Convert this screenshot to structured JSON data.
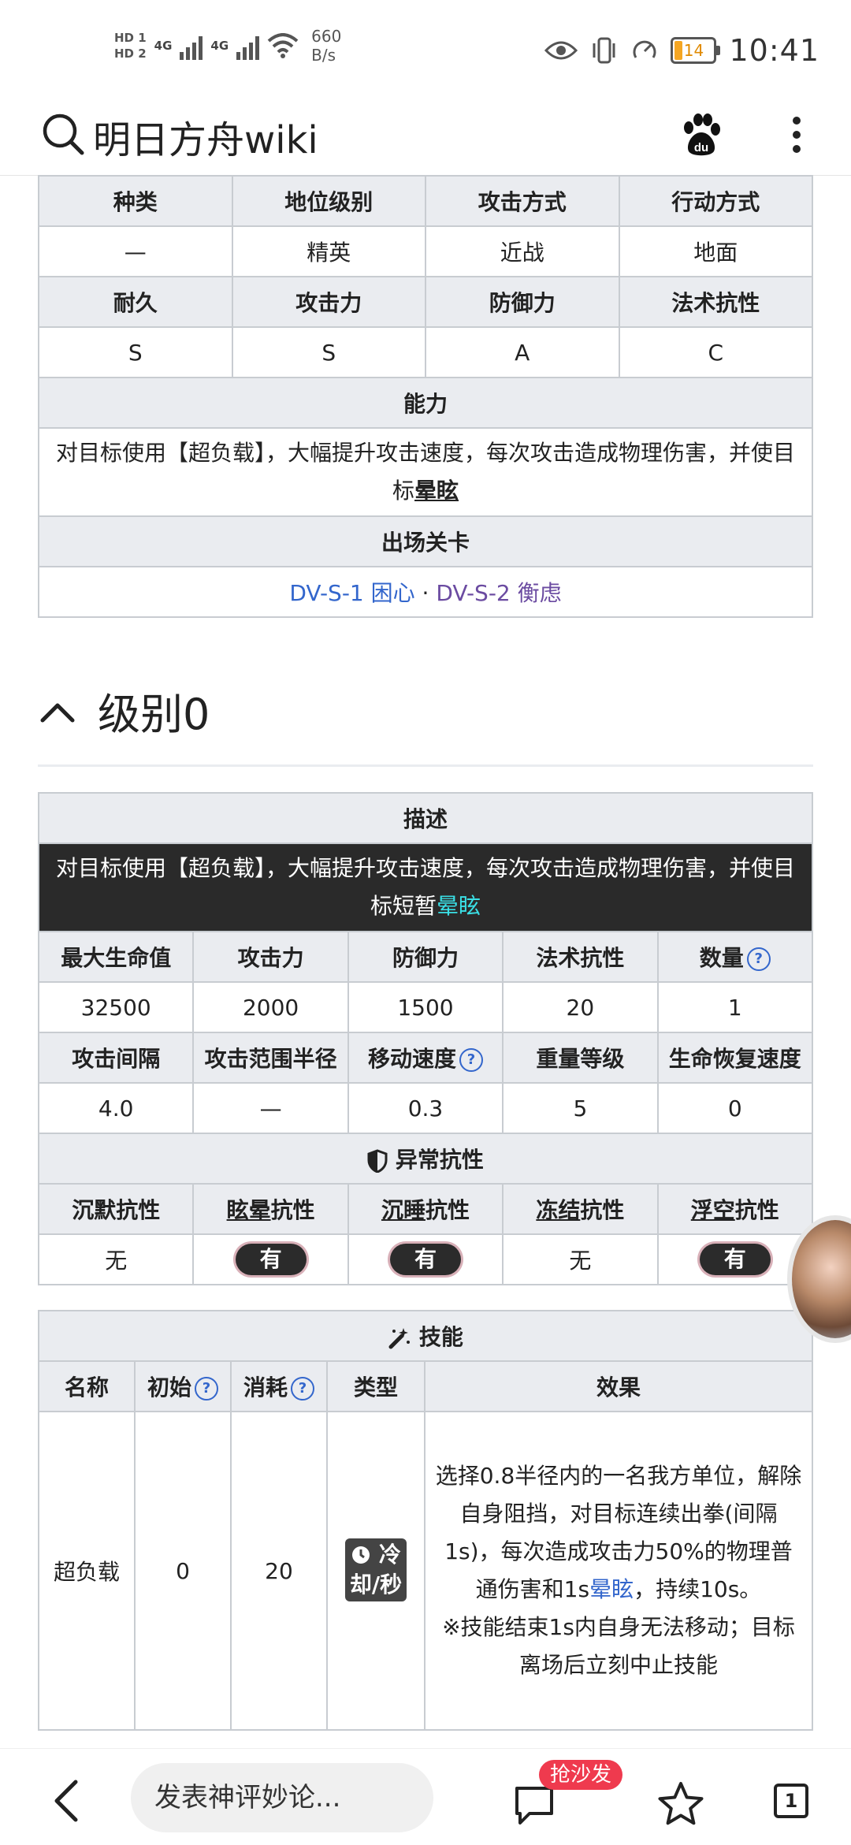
{
  "status_bar": {
    "hd1": "HD 1",
    "hd2": "HD 2",
    "net1": "4G",
    "net2": "4G",
    "speed": "660",
    "speed_unit": "B/s",
    "battery": "14",
    "time": "10:41"
  },
  "header": {
    "title": "明日方舟wiki",
    "search_icon": "search-icon",
    "baidu_icon": "baidu-icon",
    "more_icon": "more-icon"
  },
  "info_table": {
    "row1_headers": [
      "种类",
      "地位级别",
      "攻击方式",
      "行动方式"
    ],
    "row1_values": [
      "—",
      "精英",
      "近战",
      "地面"
    ],
    "row2_headers": [
      "耐久",
      "攻击力",
      "防御力",
      "法术抗性"
    ],
    "row2_values": [
      "S",
      "S",
      "A",
      "C"
    ],
    "ability_header": "能力",
    "ability_text_a": "对目标使用【超负载】，大幅提升攻击速度，每次攻击造成物理伤害，并使目标",
    "ability_text_b": "晕眩",
    "stage_header": "出场关卡",
    "stage1": "DV-S-1 困心",
    "stage_sep": "·",
    "stage2": "DV-S-2 衡虑"
  },
  "section": {
    "title": "级别0"
  },
  "level_table": {
    "desc_header": "描述",
    "desc_a": "对目标使用【超负载】，大幅提升攻击速度，每次攻击造成物理伤害，并使目标短暂",
    "desc_b": "晕眩",
    "stats1_headers": [
      "最大生命值",
      "攻击力",
      "防御力",
      "法术抗性",
      "数量"
    ],
    "stats1_values": [
      "32500",
      "2000",
      "1500",
      "20",
      "1"
    ],
    "stats2_headers": [
      "攻击间隔",
      "攻击范围半径",
      "移动速度",
      "重量等级",
      "生命恢复速度"
    ],
    "stats2_values": [
      "4.0",
      "—",
      "0.3",
      "5",
      "0"
    ],
    "resist_header": "异常抗性",
    "resist_headers": [
      {
        "a": "沉默抗性",
        "b": ""
      },
      {
        "a": "眩晕",
        "b": "抗性"
      },
      {
        "a": "沉睡",
        "b": "抗性"
      },
      {
        "a": "冻结",
        "b": "抗性"
      },
      {
        "a": "浮空",
        "b": "抗性"
      }
    ],
    "resist_values": [
      "无",
      "有",
      "无"
    ],
    "resist_has": "有",
    "q": "?"
  },
  "skill_table": {
    "header": "技能",
    "cols": [
      "名称",
      "初始",
      "消耗",
      "类型",
      "效果"
    ],
    "name": "超负载",
    "initial": "0",
    "cost": "20",
    "type_a": "冷",
    "type_b": "却/秒",
    "effect_1": "选择0.8半径内的一名我方单位，解除自身阻挡，对目标连续出拳(间隔1s)，每次造成攻击力50%的物理普通伤害和1s",
    "effect_link": "晕眩",
    "effect_2": "，持续10s。",
    "effect_3": "※技能结束1s内自身无法移动；目标离场后立刻中止技能"
  },
  "bottom_bar": {
    "comment_placeholder": "发表神评妙论...",
    "sofa_badge": "抢沙发",
    "tab_count": "1"
  },
  "colors": {
    "link_blue": "#3366cc",
    "link_purple": "#6b4ba1",
    "header_bg": "#eaecf0",
    "dark_bg": "#2a2a2a",
    "cyan": "#3ae0e6",
    "badge_red": "#ef3a4e"
  }
}
